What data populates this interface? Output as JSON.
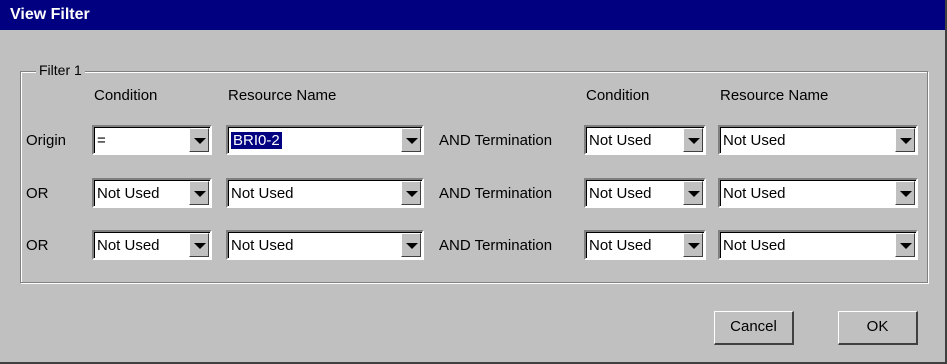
{
  "window": {
    "title": "View Filter"
  },
  "group": {
    "label": "Filter 1"
  },
  "headers": {
    "condition_left": "Condition",
    "resource_left": "Resource Name",
    "condition_right": "Condition",
    "resource_right": "Resource Name"
  },
  "rows": [
    {
      "label": "Origin",
      "condition": "=",
      "resource": "BRI0-2",
      "joiner": "AND Termination",
      "term_condition": "Not Used",
      "term_resource": "Not Used"
    },
    {
      "label": "OR",
      "condition": "Not Used",
      "resource": "Not Used",
      "joiner": "AND Termination",
      "term_condition": "Not Used",
      "term_resource": "Not Used"
    },
    {
      "label": "OR",
      "condition": "Not Used",
      "resource": "Not Used",
      "joiner": "AND Termination",
      "term_condition": "Not Used",
      "term_resource": "Not Used"
    }
  ],
  "buttons": {
    "cancel": "Cancel",
    "ok": "OK"
  },
  "colors": {
    "titlebar": "#000080",
    "face": "#c0c0c0",
    "selection": "#000080"
  },
  "icons": {
    "dropdown": "chevron-down-icon"
  }
}
